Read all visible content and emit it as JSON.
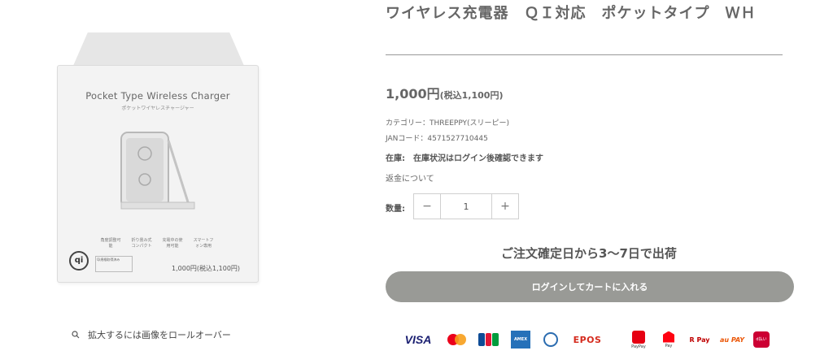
{
  "product": {
    "title": "ワイヤレス充電器　ＱＩ対応　ポケットタイプ　ＷＨ",
    "price": "1,000円",
    "price_tax": "(税込1,100円)",
    "category": "カテゴリー：THREEPPY(スリーピー)",
    "jan": "JANコード：4571527710445",
    "stock": "在庫:　在庫状況はログイン後確認できます",
    "refund_link": "返金について",
    "quantity_label": "数量:",
    "quantity_value": "1",
    "minus": "−",
    "plus": "+",
    "shipping_note": "ご注文確定日から3〜7日で出荷",
    "cart_button": "ログインしてカートに入れる"
  },
  "gallery": {
    "zoom_hint": "拡大するには画像をロールオーバー",
    "box_title": "Pocket Type Wireless Charger",
    "box_subtitle": "ポケットワイヤレスチャージャー",
    "box_icons": [
      "角度調整可能",
      "折り畳み式コンパクト",
      "充電中の使用可能",
      "スマートフォン専用"
    ],
    "box_price": "1,000円(税込1,100円)",
    "qi_mark": "qi",
    "cert_text": "Qi規格取得済み"
  },
  "payments": [
    {
      "name": "VISA",
      "icon": "visa-logo"
    },
    {
      "name": "Mastercard",
      "icon": "mastercard-logo"
    },
    {
      "name": "JCB",
      "icon": "jcb-logo"
    },
    {
      "name": "AMERICAN EXPRESS",
      "icon": "amex-logo"
    },
    {
      "name": "Diners Club",
      "icon": "diners-logo"
    },
    {
      "name": "EPOS",
      "icon": "epos-logo"
    },
    {
      "name": "PayPay",
      "icon": "paypay-logo"
    },
    {
      "name": "Pay",
      "icon": "merpay-logo"
    },
    {
      "name": "R Pay",
      "icon": "rpay-logo"
    },
    {
      "name": "au PAY",
      "icon": "aupay-logo"
    },
    {
      "name": "d払い",
      "icon": "dpay-logo"
    }
  ],
  "colors": {
    "cart_button": "#999a96",
    "text": "#666666"
  }
}
